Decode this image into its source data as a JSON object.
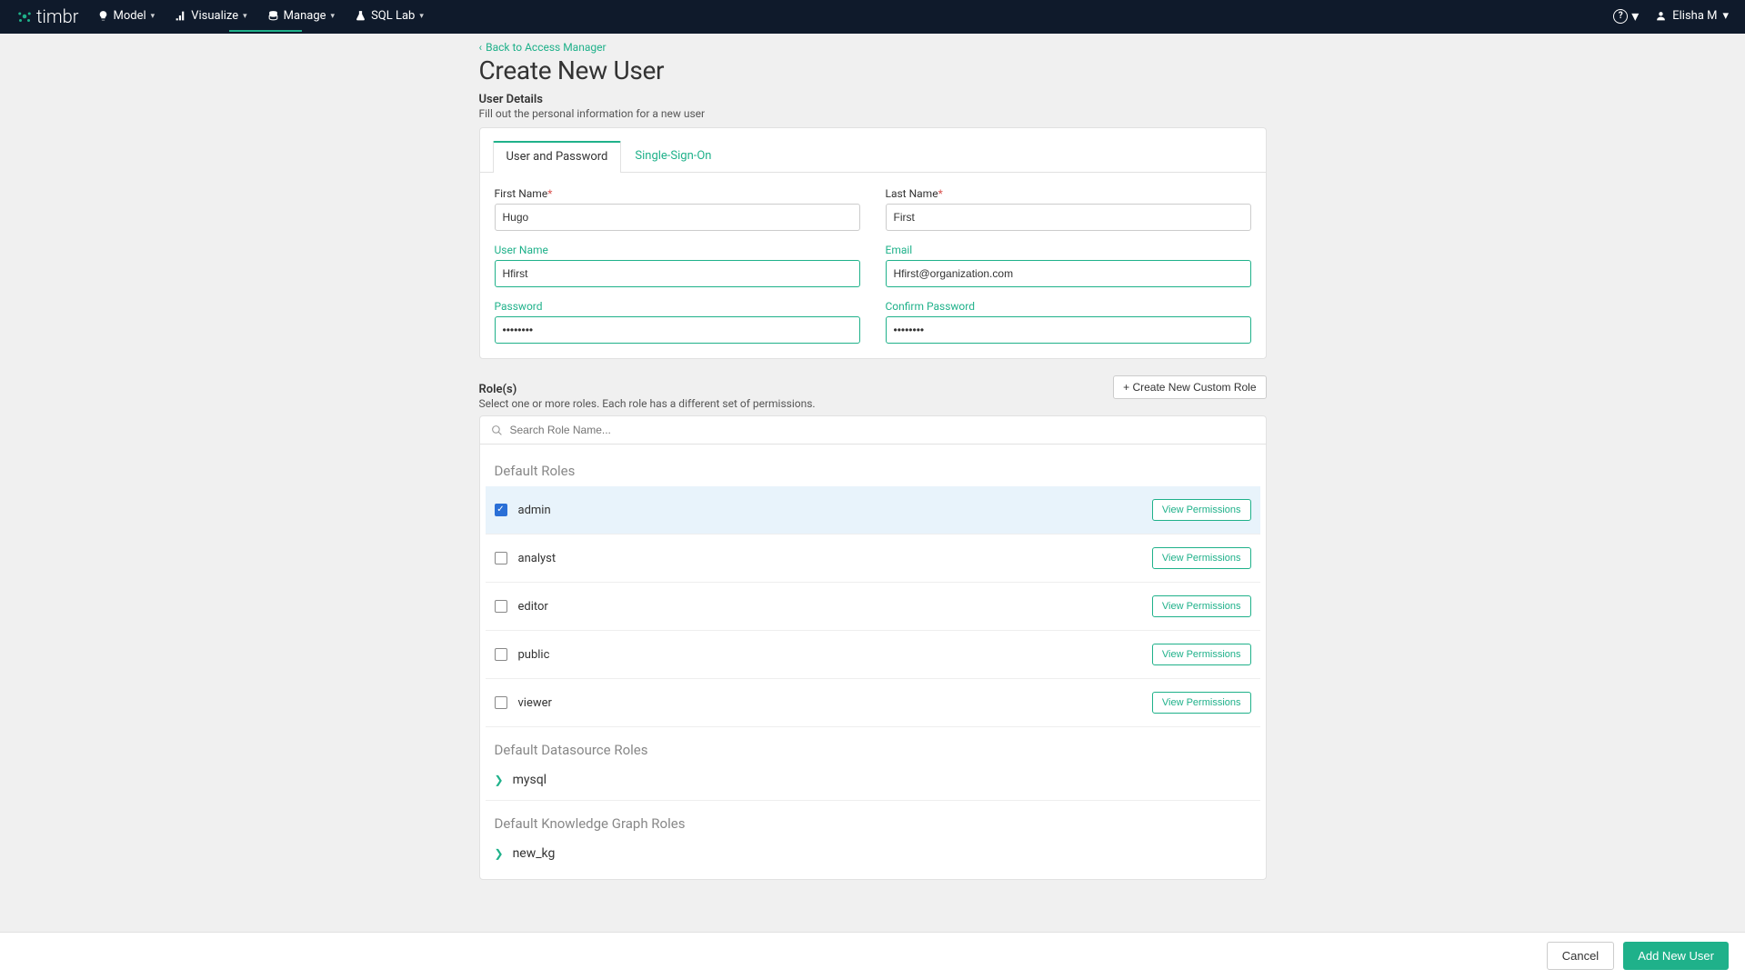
{
  "brand": "timbr",
  "nav": {
    "items": [
      {
        "label": "Model"
      },
      {
        "label": "Visualize"
      },
      {
        "label": "Manage"
      },
      {
        "label": "SQL Lab"
      }
    ],
    "user": "Elisha M"
  },
  "back_link": "Back to Access Manager",
  "page_title": "Create New User",
  "user_details": {
    "title": "User Details",
    "desc": "Fill out the personal information for a new user"
  },
  "tabs": {
    "user_pwd": "User and Password",
    "sso": "Single-Sign-On"
  },
  "form": {
    "first_name_label": "First Name",
    "first_name_value": "Hugo",
    "last_name_label": "Last Name",
    "last_name_value": "First",
    "user_name_label": "User Name",
    "user_name_value": "Hfirst",
    "email_label": "Email",
    "email_value": "Hfirst@organization.com",
    "password_label": "Password",
    "password_value": "••••••••",
    "confirm_label": "Confirm Password",
    "confirm_value": "••••••••"
  },
  "roles": {
    "title": "Role(s)",
    "desc": "Select one or more roles. Each role has a different set of permissions.",
    "create_btn": "+ Create New Custom Role",
    "search_placeholder": "Search Role Name...",
    "default_roles_title": "Default Roles",
    "view_perm_label": "View Permissions",
    "items": [
      {
        "name": "admin",
        "checked": true
      },
      {
        "name": "analyst",
        "checked": false
      },
      {
        "name": "editor",
        "checked": false
      },
      {
        "name": "public",
        "checked": false
      },
      {
        "name": "viewer",
        "checked": false
      }
    ],
    "datasource_title": "Default Datasource Roles",
    "datasource_item": "mysql",
    "kg_title": "Default Knowledge Graph Roles",
    "kg_item": "new_kg"
  },
  "footer": {
    "cancel": "Cancel",
    "submit": "Add New User"
  },
  "asterisk": "*"
}
